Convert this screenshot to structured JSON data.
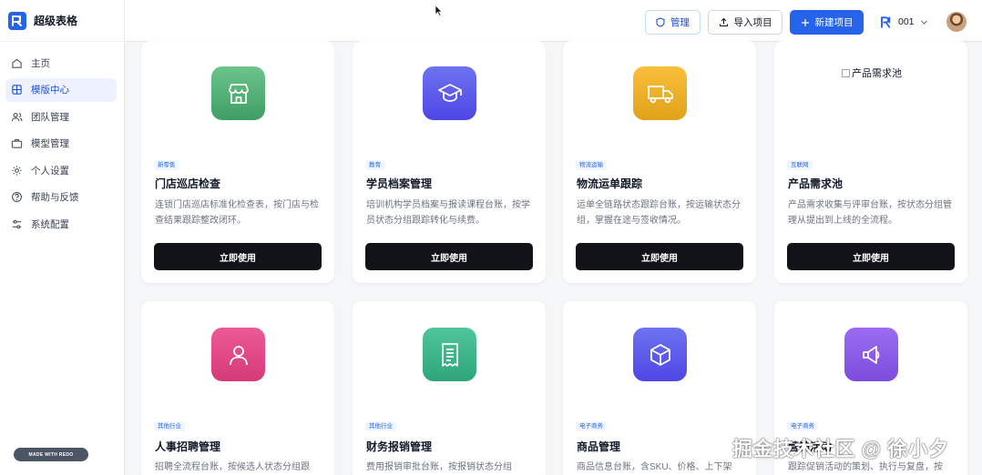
{
  "app": {
    "name": "超级表格"
  },
  "sidebar": {
    "items": [
      {
        "label": "主页",
        "icon": "home-icon"
      },
      {
        "label": "模版中心",
        "icon": "grid-icon",
        "active": true
      },
      {
        "label": "团队管理",
        "icon": "users-icon"
      },
      {
        "label": "模型管理",
        "icon": "briefcase-icon"
      },
      {
        "label": "个人设置",
        "icon": "gear-icon"
      },
      {
        "label": "帮助与反馈",
        "icon": "help-icon"
      },
      {
        "label": "系统配置",
        "icon": "sliders-icon"
      }
    ],
    "made_with": "MADE WITH REDO"
  },
  "topbar": {
    "admin_label": "管理",
    "import_label": "导入项目",
    "new_label": "新建项目",
    "workspace": "001"
  },
  "cards": [
    {
      "tag": "新零售",
      "title": "门店巡店检查",
      "desc": "连锁门店巡店标准化检查表，按门店与检查结果跟踪整改闭环。",
      "button": "立即使用",
      "icon": "store-icon",
      "color_from": "#6bc58b",
      "color_to": "#3f9e64"
    },
    {
      "tag": "教育",
      "title": "学员档案管理",
      "desc": "培训机构学员档案与报读课程台账，按学员状态分组跟踪转化与续费。",
      "button": "立即使用",
      "icon": "graduation-cap-icon",
      "color_from": "#6d73f0",
      "color_to": "#4f46e5"
    },
    {
      "tag": "物流运输",
      "title": "物流运单跟踪",
      "desc": "运单全链路状态跟踪台账，按运输状态分组，掌握在途与签收情况。",
      "button": "立即使用",
      "icon": "truck-icon",
      "color_from": "#fbbf3c",
      "color_to": "#e0a21a"
    },
    {
      "tag": "互联网",
      "title": "产品需求池",
      "desc": "产品需求收集与评审台账，按状态分组管理从提出到上线的全流程。",
      "button": "立即使用",
      "icon": "broken-image",
      "image_alt": "产品需求池"
    },
    {
      "tag": "其他行业",
      "title": "人事招聘管理",
      "desc": "招聘全流程台账，按候选人状态分组跟",
      "icon": "user-icon",
      "color_from": "#ec5a95",
      "color_to": "#d63a78"
    },
    {
      "tag": "其他行业",
      "title": "财务报销管理",
      "desc": "费用报销审批台账，按报销状态分组",
      "icon": "receipt-icon",
      "color_from": "#4fc79a",
      "color_to": "#2ea57a"
    },
    {
      "tag": "电子商务",
      "title": "商品管理",
      "desc": "商品信息台账，含SKU、价格、上下架",
      "icon": "box-icon",
      "color_from": "#6d73f0",
      "color_to": "#4f46e5"
    },
    {
      "tag": "电子商务",
      "title": "营销活动",
      "desc": "跟踪促销活动的策划、执行与复盘，按",
      "icon": "megaphone-icon",
      "color_from": "#9b6cf2",
      "color_to": "#7c4ddc"
    }
  ],
  "watermark": "掘金技术社区 @ 徐小夕"
}
